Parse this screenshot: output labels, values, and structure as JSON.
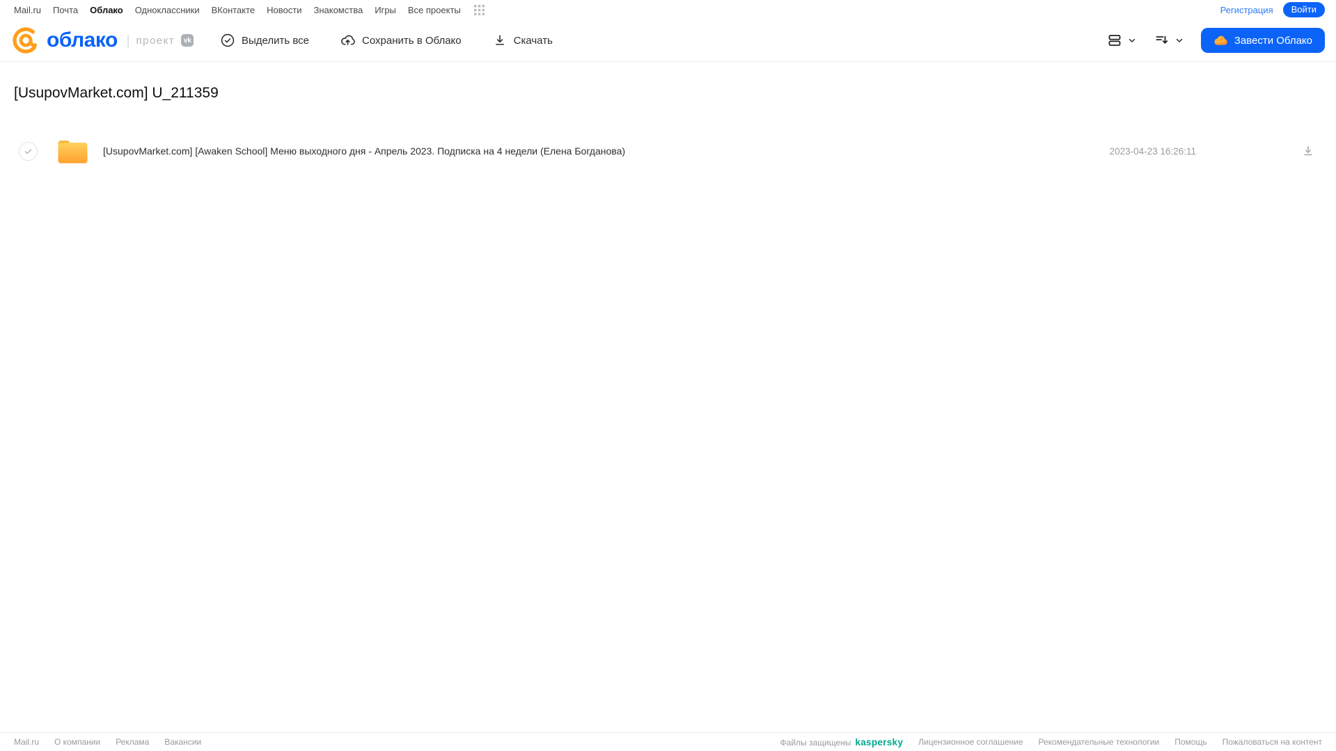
{
  "topnav": {
    "items": [
      "Mail.ru",
      "Почта",
      "Облако",
      "Одноклассники",
      "ВКонтакте",
      "Новости",
      "Знакомства",
      "Игры",
      "Все проекты"
    ],
    "active_item": "Облако",
    "registration": "Регистрация",
    "login": "Войти"
  },
  "header": {
    "logo": {
      "name": "облако",
      "divider": "|",
      "project": "проект",
      "vk": "vk"
    },
    "toolbar": {
      "select_all": "Выделить все",
      "save_to_cloud": "Сохранить в Облако",
      "download": "Скачать"
    },
    "get_cloud_button": "Завести Облако"
  },
  "main": {
    "title": "[UsupovMarket.com] U_211359",
    "files": [
      {
        "type": "folder",
        "name": "[UsupovMarket.com] [Awaken School] Меню выходного дня - Апрель 2023. Подписка на 4 недели (Елена Богданова)",
        "date": "2023-04-23 16:26:11"
      }
    ]
  },
  "footer": {
    "left_links": [
      "Mail.ru",
      "О компании",
      "Реклама",
      "Вакансии"
    ],
    "protected_label": "Файлы защищены",
    "kaspersky": "kaspersky",
    "right_links": [
      "Лицензионное соглашение",
      "Рекомендательные технологии",
      "Помощь",
      "Пожаловаться на контент"
    ]
  },
  "colors": {
    "accent_blue": "#0b63f8",
    "logo_orange": "#ff9e1b",
    "folder_top": "#ffd15c",
    "folder_bottom": "#ffa12e",
    "kaspersky_green": "#00a88e",
    "muted_text": "#9a9a9a"
  }
}
